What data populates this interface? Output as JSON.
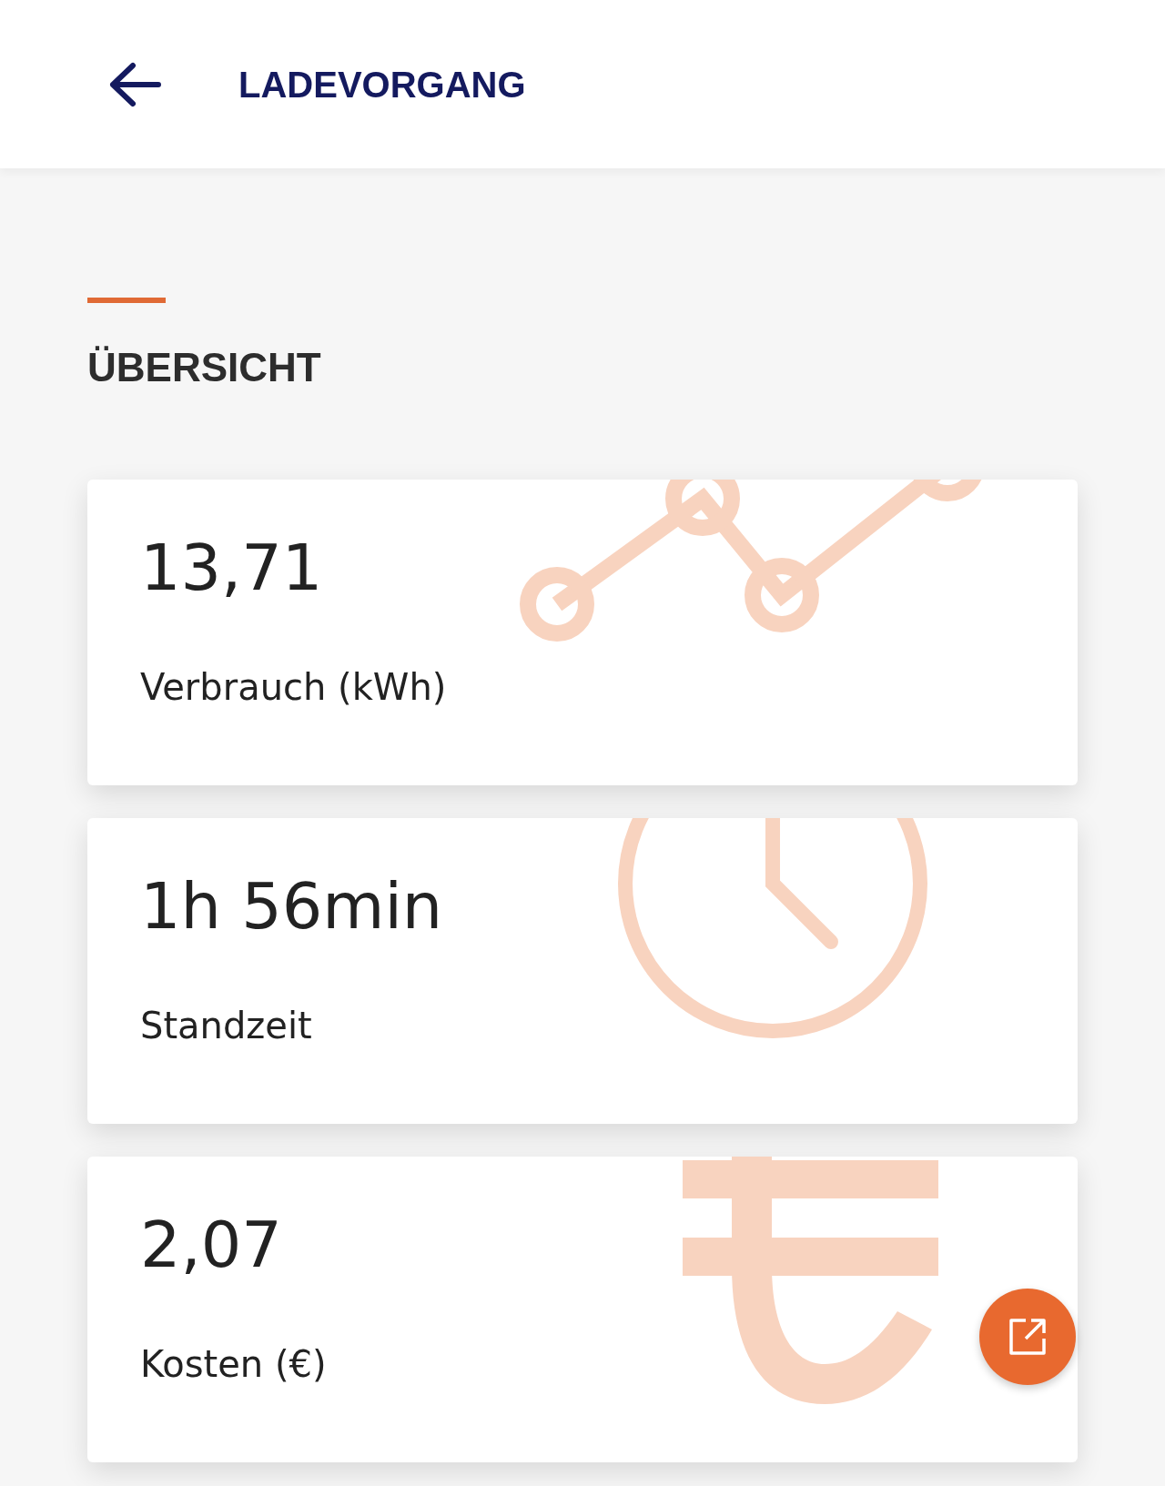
{
  "header": {
    "title": "LADEVORGANG"
  },
  "section": {
    "title": "ÜBERSICHT"
  },
  "cards": [
    {
      "kind": "chart",
      "value": "13,71",
      "label": "Verbrauch (kWh)"
    },
    {
      "kind": "clock",
      "value": "1h 56min",
      "label": "Standzeit"
    },
    {
      "kind": "euro",
      "value": "2,07",
      "label": "Kosten (€)"
    }
  ]
}
